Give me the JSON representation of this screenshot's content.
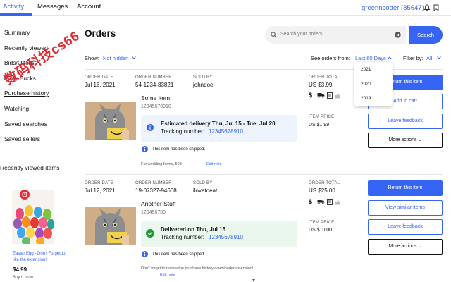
{
  "tabs": [
    {
      "label": "Activity"
    },
    {
      "label": "Messages"
    },
    {
      "label": "Account"
    }
  ],
  "user": {
    "name": "greenncoder (85647)"
  },
  "sidebar": {
    "items": [
      {
        "label": "Summary"
      },
      {
        "label": "Recently viewed"
      },
      {
        "label": "Bids/Offers"
      },
      {
        "label": "eBay Bucks"
      },
      {
        "label": "Purchase history"
      },
      {
        "label": "Watching"
      },
      {
        "label": "Saved searches"
      },
      {
        "label": "Saved sellers"
      }
    ],
    "recently_viewed": {
      "title": "Recently viewed items",
      "item_title": "Easter Egg - Don't Forget to like the extension!",
      "price": "$4.99",
      "buy_it_now": "Buy It Now"
    }
  },
  "page": {
    "title": "Orders"
  },
  "search": {
    "placeholder": "Search your orders",
    "button": "Search"
  },
  "filters": {
    "show_label": "Show:",
    "show_value": "Not hidden",
    "see_from_label": "See orders from:",
    "see_from_value": "Last 60 Days",
    "filter_by_label": "Filter by:",
    "filter_by_value": "All",
    "year_options": [
      "2021",
      "2020",
      "2019"
    ]
  },
  "watermark": {
    "text": "数码科技cs66"
  },
  "labels": {
    "order_date": "ORDER DATE",
    "order_number": "ORDER NUMBER",
    "sold_by": "SOLD BY",
    "order_total": "ORDER TOTAL",
    "item_price": "ITEM PRICE:"
  },
  "orders": [
    {
      "order_date": "Jul 16, 2021",
      "order_number": "54-1234-83821",
      "seller": "johndoe",
      "order_total": "US $3.99",
      "item_title": "Some Item",
      "item_number": "12345678910",
      "status_title": "Estimated delivery Thu, Jul 15 - Tue, Jul 20",
      "tracking_label": "Tracking number:",
      "tracking_number": "12345678910",
      "item_price": "US $1.99",
      "shipped_note": "This item has been shipped.",
      "note": "For wedding farms, 508",
      "edit_note": "Edit note",
      "buttons": [
        "Return this item",
        "Add to cart",
        "Leave feedback",
        "More actions"
      ],
      "status_color": "blue"
    },
    {
      "order_date": "Jul 12, 2021",
      "order_number": "19-07327-94608",
      "seller": "ilovetoeat",
      "order_total": "US $25.00",
      "item_title": "Another Stuff",
      "item_number": "123456789",
      "status_title": "Delivered on Thu, Jul 15",
      "tracking_label": "Tracking number:",
      "tracking_number": "12345678910",
      "item_price": "US $10.00",
      "shipped_note": "This item has been shipped.",
      "note": "Don't forget to review the purchase history downloader extension!",
      "edit_note": "Edit note",
      "buttons": [
        "Return this item",
        "View similar items",
        "Leave feedback",
        "More actions"
      ],
      "status_color": "green"
    }
  ],
  "colors": {
    "accent": "#3665f3",
    "delivered": "#1e9a3a",
    "watermark": "#d9232d"
  }
}
